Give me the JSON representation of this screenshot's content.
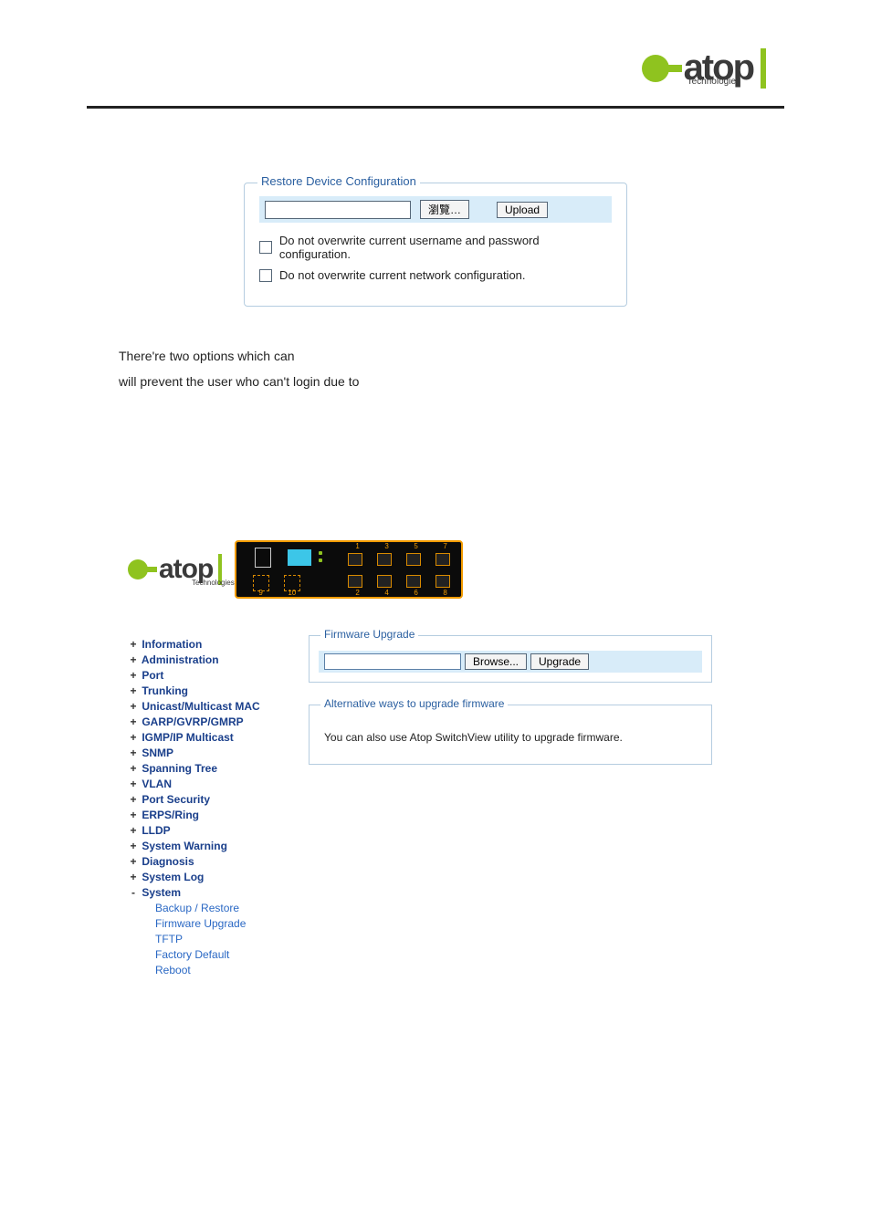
{
  "logo": {
    "brand": "atop",
    "tagline": "Technologies"
  },
  "restore_panel": {
    "legend": "Restore Device Configuration",
    "browse_label": "瀏覽…",
    "upload_label": "Upload",
    "chk1": "Do not overwrite current username and password configuration.",
    "chk2": "Do not overwrite current network configuration."
  },
  "para_line1": "There're two options which can",
  "para_line2": " will prevent the user who can't login due to",
  "nav": {
    "items": [
      {
        "bullet": "+",
        "label": "Information",
        "bold": true
      },
      {
        "bullet": "+",
        "label": "Administration",
        "bold": true
      },
      {
        "bullet": "+",
        "label": "Port",
        "bold": true
      },
      {
        "bullet": "+",
        "label": "Trunking",
        "bold": true
      },
      {
        "bullet": "+",
        "label": "Unicast/Multicast MAC",
        "bold": true
      },
      {
        "bullet": "+",
        "label": "GARP/GVRP/GMRP",
        "bold": true
      },
      {
        "bullet": "+",
        "label": "IGMP/IP Multicast",
        "bold": true
      },
      {
        "bullet": "+",
        "label": "SNMP",
        "bold": true
      },
      {
        "bullet": "+",
        "label": "Spanning Tree",
        "bold": true
      },
      {
        "bullet": "+",
        "label": "VLAN",
        "bold": true
      },
      {
        "bullet": "+",
        "label": "Port Security",
        "bold": true
      },
      {
        "bullet": "+",
        "label": "ERPS/Ring",
        "bold": true
      },
      {
        "bullet": "+",
        "label": "LLDP",
        "bold": true
      },
      {
        "bullet": "+",
        "label": "System Warning",
        "bold": true
      },
      {
        "bullet": "+",
        "label": "Diagnosis",
        "bold": true
      },
      {
        "bullet": "+",
        "label": "System Log",
        "bold": true
      },
      {
        "bullet": "-",
        "label": "System",
        "bold": true
      }
    ],
    "sub": [
      "Backup / Restore",
      "Firmware Upgrade",
      "TFTP",
      "Factory Default",
      "Reboot"
    ]
  },
  "switch_ports_top": [
    "1",
    "3",
    "5",
    "7"
  ],
  "switch_ports_bottom_left": [
    "9",
    "10"
  ],
  "switch_ports_bottom_right": [
    "2",
    "4",
    "6",
    "8"
  ],
  "firmware_panel": {
    "legend": "Firmware Upgrade",
    "browse_label": "Browse...",
    "upgrade_label": "Upgrade"
  },
  "alt_panel": {
    "legend": "Alternative ways to upgrade firmware",
    "text": "You can also use Atop SwitchView utility to upgrade firmware."
  }
}
